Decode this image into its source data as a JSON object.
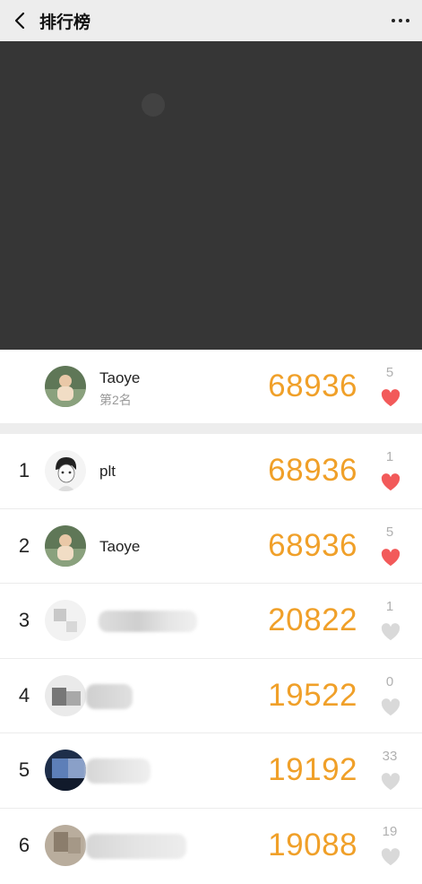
{
  "nav": {
    "title": "排行榜",
    "back_icon": "chevron-left-icon",
    "more_icon": "more-dots-icon"
  },
  "colors": {
    "score": "#f0a029",
    "heart_liked": "#f25a5a",
    "heart_unliked": "#d9d9d9",
    "banner_bg": "#363636"
  },
  "mine": {
    "name": "Taoye",
    "rank_text": "第2名",
    "score": "68936",
    "likes": "5",
    "liked": true
  },
  "rows": [
    {
      "rank": "1",
      "name": "plt",
      "score": "68936",
      "likes": "1",
      "liked": true
    },
    {
      "rank": "2",
      "name": "Taoye",
      "score": "68936",
      "likes": "5",
      "liked": true
    },
    {
      "rank": "3",
      "name": "",
      "score": "20822",
      "likes": "1",
      "liked": false
    },
    {
      "rank": "4",
      "name": "",
      "score": "19522",
      "likes": "0",
      "liked": false
    },
    {
      "rank": "5",
      "name": "",
      "score": "19192",
      "likes": "33",
      "liked": false
    },
    {
      "rank": "6",
      "name": "",
      "score": "19088",
      "likes": "19",
      "liked": false
    }
  ]
}
